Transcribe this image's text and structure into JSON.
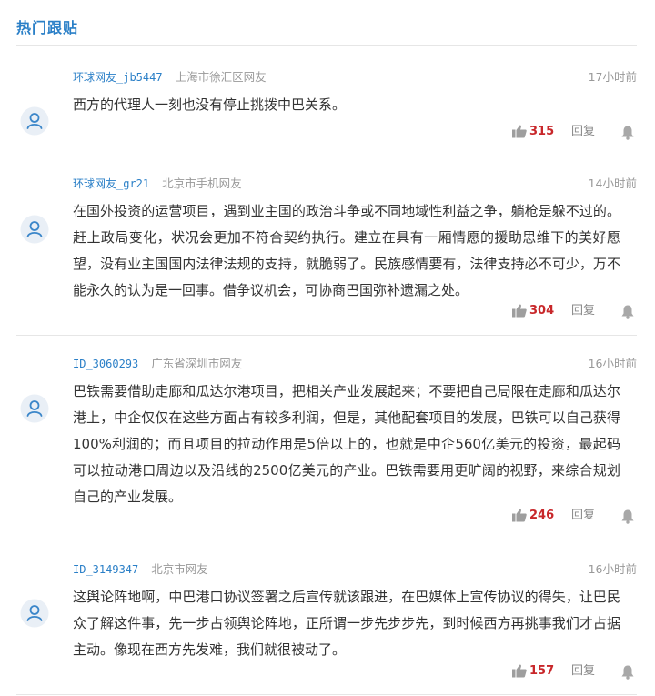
{
  "section": {
    "title": "热门跟贴"
  },
  "colors": {
    "accent": "#2a7fc7",
    "like": "#c8272a",
    "muted": "#999999"
  },
  "icons": {
    "avatar": "user-avatar-icon",
    "like": "thumbs-up-icon",
    "report": "bell-icon"
  },
  "comments": [
    {
      "user": "环球网友_jb5447",
      "location": "上海市徐汇区网友",
      "time": "17小时前",
      "text": "西方的代理人一刻也没有停止挑拨中巴关系。",
      "likes": "315",
      "reply": "回复"
    },
    {
      "user": "环球网友_gr21",
      "location": "北京市手机网友",
      "time": "14小时前",
      "text": "在国外投资的运营项目，遇到业主国的政治斗争或不同地域性利益之争，躺枪是躲不过的。赶上政局变化，状况会更加不符合契约执行。建立在具有一厢情愿的援助思维下的美好愿望，没有业主国国内法律法规的支持，就脆弱了。民族感情要有，法律支持必不可少，万不能永久的认为是一回事。借争议机会，可协商巴国弥补遗漏之处。",
      "likes": "304",
      "reply": "回复"
    },
    {
      "user": "ID_3060293",
      "location": "广东省深圳市网友",
      "time": "16小时前",
      "text": "巴铁需要借助走廊和瓜达尔港项目，把相关产业发展起来；不要把自己局限在走廊和瓜达尔港上，中企仅仅在这些方面占有较多利润，但是，其他配套项目的发展，巴铁可以自己获得100%利润的；而且项目的拉动作用是5倍以上的，也就是中企560亿美元的投资，最起码可以拉动港口周边以及沿线的2500亿美元的产业。巴铁需要用更旷阔的视野，来综合规划自己的产业发展。",
      "likes": "246",
      "reply": "回复"
    },
    {
      "user": "ID_3149347",
      "location": "北京市网友",
      "time": "16小时前",
      "text": "这舆论阵地啊，中巴港口协议签署之后宣传就该跟进，在巴媒体上宣传协议的得失，让巴民众了解这件事，先一步占领舆论阵地，正所谓一步先步步先，到时候西方再挑事我们才占据主动。像现在西方先发难，我们就很被动了。",
      "likes": "157",
      "reply": "回复"
    }
  ]
}
